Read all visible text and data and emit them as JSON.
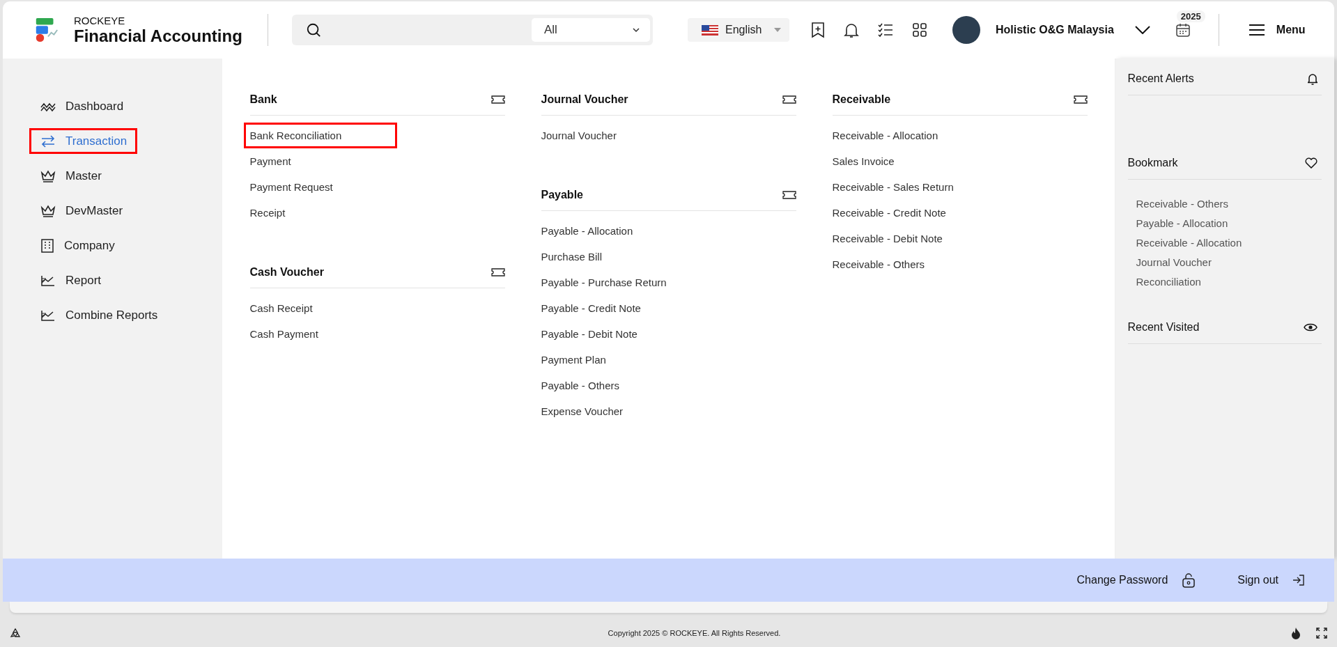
{
  "header": {
    "brand": "ROCKEYE",
    "product": "Financial Accounting",
    "search_scope": "All",
    "language": "English",
    "user_name": "Holistic O&G Malaysia",
    "year_badge": "2025",
    "menu_label": "Menu"
  },
  "sidebar": {
    "items": [
      {
        "label": "Dashboard",
        "selected": false,
        "highlighted": false
      },
      {
        "label": "Transaction",
        "selected": true,
        "highlighted": true
      },
      {
        "label": "Master",
        "selected": false,
        "highlighted": false
      },
      {
        "label": "DevMaster",
        "selected": false,
        "highlighted": false
      },
      {
        "label": "Company",
        "selected": false,
        "highlighted": false
      },
      {
        "label": "Report",
        "selected": false,
        "highlighted": false
      },
      {
        "label": "Combine Reports",
        "selected": false,
        "highlighted": false
      }
    ]
  },
  "menu_columns": [
    {
      "sections": [
        {
          "title": "Bank",
          "items": [
            {
              "label": "Bank Reconciliation",
              "highlighted": true
            },
            {
              "label": "Payment",
              "highlighted": false
            },
            {
              "label": "Payment Request",
              "highlighted": false
            },
            {
              "label": "Receipt",
              "highlighted": false
            }
          ]
        },
        {
          "title": "Cash Voucher",
          "items": [
            {
              "label": "Cash Receipt",
              "highlighted": false
            },
            {
              "label": "Cash Payment",
              "highlighted": false
            }
          ]
        }
      ]
    },
    {
      "sections": [
        {
          "title": "Journal Voucher",
          "items": [
            {
              "label": "Journal Voucher",
              "highlighted": false
            }
          ]
        },
        {
          "title": "Payable",
          "items": [
            {
              "label": "Payable - Allocation",
              "highlighted": false
            },
            {
              "label": "Purchase Bill",
              "highlighted": false
            },
            {
              "label": "Payable - Purchase Return",
              "highlighted": false
            },
            {
              "label": "Payable - Credit Note",
              "highlighted": false
            },
            {
              "label": "Payable - Debit Note",
              "highlighted": false
            },
            {
              "label": "Payment Plan",
              "highlighted": false
            },
            {
              "label": "Payable - Others",
              "highlighted": false
            },
            {
              "label": "Expense Voucher",
              "highlighted": false
            }
          ]
        }
      ]
    },
    {
      "sections": [
        {
          "title": "Receivable",
          "items": [
            {
              "label": "Receivable - Allocation",
              "highlighted": false
            },
            {
              "label": "Sales Invoice",
              "highlighted": false
            },
            {
              "label": "Receivable - Sales Return",
              "highlighted": false
            },
            {
              "label": "Receivable - Credit Note",
              "highlighted": false
            },
            {
              "label": "Receivable - Debit Note",
              "highlighted": false
            },
            {
              "label": "Receivable - Others",
              "highlighted": false
            }
          ]
        }
      ]
    }
  ],
  "right_panel": {
    "sections": [
      {
        "title": "Recent Alerts",
        "kind": "alerts"
      },
      {
        "title": "Bookmark",
        "kind": "bookmark",
        "items": [
          "Receivable - Others",
          "Payable - Allocation",
          "Receivable - Allocation",
          "Journal Voucher",
          "Reconciliation"
        ]
      },
      {
        "title": "Recent Visited",
        "kind": "visited"
      }
    ]
  },
  "account_bar": {
    "change_password": "Change Password",
    "sign_out": "Sign out"
  },
  "footer": {
    "copyright": "Copyright 2025 © ROCKEYE. All Rights Reserved."
  }
}
